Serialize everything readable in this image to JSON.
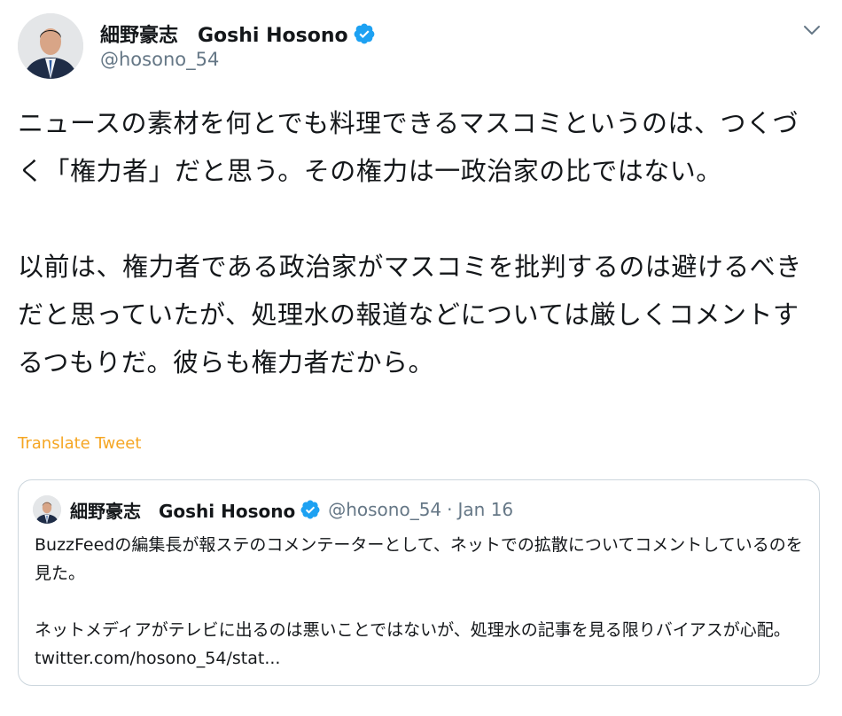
{
  "author": {
    "name": "細野豪志　Goshi Hosono",
    "handle": "@hosono_54"
  },
  "tweet": {
    "text": "ニュースの素材を何とでも料理できるマスコミというのは、つくづく「権力者」だと思う。その権力は一政治家の比ではない。\n\n以前は、権力者である政治家がマスコミを批判するのは避けるべきだと思っていたが、処理水の報道などについては厳しくコメントするつもりだ。彼らも権力者だから。",
    "translate_label": "Translate Tweet"
  },
  "quoted": {
    "name": "細野豪志　Goshi Hosono",
    "handle": "@hosono_54",
    "separator": "·",
    "date": "Jan 16",
    "text": "BuzzFeedの編集長が報ステのコメンテーターとして、ネットでの拡散についてコメントしているのを見た。\n\nネットメディアがテレビに出るのは悪いことではないが、処理水の記事を見る限りバイアスが心配。 twitter.com/hosono_54/stat..."
  },
  "colors": {
    "verified": "#1da1f2",
    "translate": "#f5a623",
    "muted": "#657786",
    "border": "#ccd6dd"
  },
  "icons": {
    "verified": "verified-badge-icon",
    "menu": "chevron-down-icon"
  }
}
